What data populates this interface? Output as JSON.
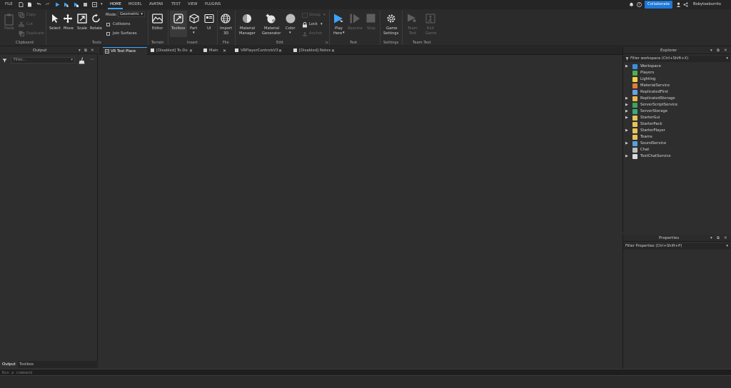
{
  "menubar": {
    "file": "FILE",
    "tabs": [
      "HOME",
      "MODEL",
      "AVATAR",
      "TEST",
      "VIEW",
      "PLUGINS"
    ],
    "collaborate": "Collaborate",
    "username": "Bobytoeburrito"
  },
  "ribbon": {
    "clipboard": {
      "paste": "Paste",
      "copy": "Copy",
      "cut": "Cut",
      "duplicate": "Duplicate",
      "label": "Clipboard"
    },
    "tools": {
      "select": "Select",
      "move": "Move",
      "scale": "Scale",
      "rotate": "Rotate",
      "mode_label": "Mode:",
      "mode_value": "Geometric",
      "collisions": "Collisions",
      "join_surfaces": "Join Surfaces",
      "label": "Tools"
    },
    "terrain": {
      "editor": "Editor",
      "label": "Terrain"
    },
    "insert": {
      "toolbox": "Toolbox",
      "part": "Part",
      "ui": "UI",
      "label": "Insert"
    },
    "file": {
      "import_line1": "Import",
      "import_line2": "3D",
      "label": "File"
    },
    "edit": {
      "material_manager_1": "Material",
      "material_manager_2": "Manager",
      "material_generator_1": "Material",
      "material_generator_2": "Generator",
      "color": "Color",
      "group": "Group",
      "lock": "Lock",
      "anchor": "Anchor",
      "label": "Edit"
    },
    "test": {
      "play_1": "Play",
      "play_2": "Here",
      "resume": "Resume",
      "stop": "Stop",
      "label": "Test"
    },
    "settings": {
      "game_1": "Game",
      "game_2": "Settings",
      "label": "Settings"
    },
    "team_test": {
      "team_1": "Team",
      "team_2": "Test",
      "exit_1": "Exit",
      "exit_2": "Game",
      "label": "Team Test"
    }
  },
  "output": {
    "title": "Output",
    "filter_placeholder": "Filter..."
  },
  "doc_tabs": [
    {
      "label": "VR Test Place"
    },
    {
      "label": "[Disabled] To-Do"
    },
    {
      "label": "Main"
    },
    {
      "label": "VRPlayerControlsV3"
    },
    {
      "label": "[Disabled] Notes"
    }
  ],
  "explorer": {
    "title": "Explorer",
    "filter": "Filter workspace (Ctrl+Shift+X)",
    "items": [
      {
        "label": "Workspace",
        "icon": "globe-icon",
        "color": "#3b8fe0",
        "expandable": true
      },
      {
        "label": "Players",
        "icon": "players-icon",
        "color": "#4caf50",
        "expandable": false
      },
      {
        "label": "Lighting",
        "icon": "lightbulb-icon",
        "color": "#f2d14a",
        "expandable": false
      },
      {
        "label": "MaterialService",
        "icon": "material-icon",
        "color": "#e07b39",
        "expandable": false
      },
      {
        "label": "ReplicatedFirst",
        "icon": "replicated-first-icon",
        "color": "#6aa0e8",
        "expandable": false
      },
      {
        "label": "ReplicatedStorage",
        "icon": "replicated-storage-icon",
        "color": "#e8b84a",
        "expandable": true
      },
      {
        "label": "ServerScriptService",
        "icon": "server-script-icon",
        "color": "#3fa35a",
        "expandable": true
      },
      {
        "label": "ServerStorage",
        "icon": "server-storage-icon",
        "color": "#3aa87a",
        "expandable": true
      },
      {
        "label": "StarterGui",
        "icon": "starter-gui-icon",
        "color": "#e8c25a",
        "expandable": true
      },
      {
        "label": "StarterPack",
        "icon": "starter-pack-icon",
        "color": "#e8c25a",
        "expandable": false
      },
      {
        "label": "StarterPlayer",
        "icon": "starter-player-icon",
        "color": "#e8c25a",
        "expandable": true
      },
      {
        "label": "Teams",
        "icon": "teams-icon",
        "color": "#e8c25a",
        "expandable": false
      },
      {
        "label": "SoundService",
        "icon": "sound-icon",
        "color": "#5aa0e0",
        "expandable": true
      },
      {
        "label": "Chat",
        "icon": "chat-icon",
        "color": "#bdbdbd",
        "expandable": false
      },
      {
        "label": "TextChatService",
        "icon": "text-chat-icon",
        "color": "#dcdcdc",
        "expandable": true
      }
    ]
  },
  "properties": {
    "title": "Properties",
    "filter": "Filter Properties (Ctrl+Shift+P)"
  },
  "bottom_tabs": {
    "output": "Output",
    "toolbox": "Toolbox"
  },
  "command_bar": {
    "placeholder": "Run a command"
  }
}
